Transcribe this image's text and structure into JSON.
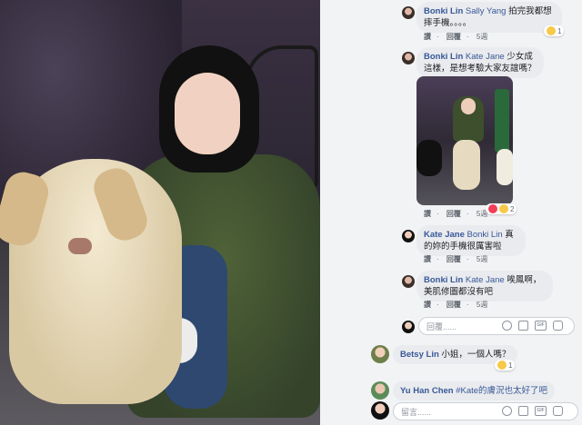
{
  "comments": [
    {
      "author": "Bonki Lin",
      "tag": "Sally Yang",
      "text": "拍完我都想摔手機。。。。",
      "like": "讚",
      "reply": "回覆",
      "time": "5週",
      "reaction_count": "1"
    },
    {
      "author": "Bonki Lin",
      "tag": "Kate Jane",
      "text": "少女成這樣，是想考驗大家友誼嗎？",
      "like": "讚",
      "reply": "回覆",
      "time": "5週",
      "reaction_count": "2"
    },
    {
      "author": "Kate Jane",
      "tag": "Bonki Lin",
      "text": "真的妳的手機很厲害啦",
      "like": "讚",
      "reply": "回覆",
      "time": "5週"
    },
    {
      "author": "Bonki Lin",
      "tag": "Kate Jane",
      "text": "唉鳳啊，美肌修圖都沒有吧",
      "like": "讚",
      "reply": "回覆",
      "time": "5週"
    }
  ],
  "reply_input": {
    "placeholder": "回覆......"
  },
  "top_comments": [
    {
      "author": "Betsy Lin",
      "text": "小姐，一個人嗎？",
      "reaction_count": "1"
    },
    {
      "author": "Yu Han Chen",
      "text": "#Kate的膚況也太好了吧"
    }
  ],
  "comment_input": {
    "placeholder": "留言......"
  },
  "icons": [
    "smile-icon",
    "camera-icon",
    "gif-icon",
    "sticker-icon"
  ],
  "colors": {
    "link": "#385898",
    "bubble": "#e9ebee",
    "panel": "#f2f3f5"
  }
}
